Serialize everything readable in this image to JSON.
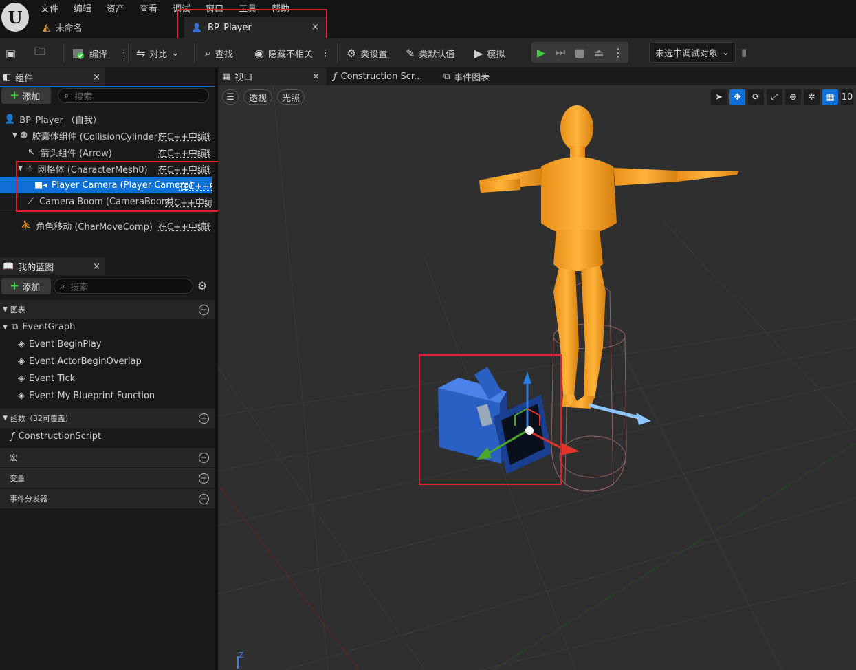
{
  "menu": [
    "文件",
    "编辑",
    "资产",
    "查看",
    "调试",
    "窗口",
    "工具",
    "帮助"
  ],
  "docs": {
    "untitled": "未命名",
    "active_tab": "BP_Player"
  },
  "toolbar": {
    "compile": "编译",
    "diff": "对比",
    "find": "查找",
    "hide_unrelated": "隐藏不相关",
    "class_settings": "类设置",
    "class_defaults": "类默认值",
    "simulate": "模拟",
    "debug_object": "未选中调试对象"
  },
  "components": {
    "tab": "组件",
    "add": "添加",
    "search_placeholder": "搜索",
    "root": "BP_Player （自我）",
    "edit_cpp": "在C++中编辑",
    "edit_cpp_short": "在C++中",
    "items": [
      {
        "label": "胶囊体组件 (CollisionCylinder)"
      },
      {
        "label": "箭头组件 (Arrow)"
      },
      {
        "label": "网格体 (CharacterMesh0)"
      },
      {
        "label": "Player Camera (Player Camera)"
      },
      {
        "label": "Camera Boom (CameraBoom)"
      },
      {
        "label": "角色移动 (CharMoveComp)"
      }
    ]
  },
  "myblueprint": {
    "tab": "我的蓝图",
    "add": "添加",
    "search_placeholder": "搜索",
    "graphs": "图表",
    "eventgraph": "EventGraph",
    "events": [
      "Event BeginPlay",
      "Event ActorBeginOverlap",
      "Event Tick",
      "Event My Blueprint Function"
    ],
    "functions": "函数（32可覆盖）",
    "construction": "ConstructionScript",
    "macros": "宏",
    "variables": "变量",
    "dispatchers": "事件分发器"
  },
  "viewport": {
    "tabs": [
      "视口",
      "Construction Scr...",
      "事件图表"
    ],
    "perspective": "透视",
    "lit": "光照",
    "grid_value": "10",
    "axis_label": "Z"
  },
  "colors": {
    "accent": "#0e6fd6",
    "highlight_box": "#e0212b",
    "play": "#3fcb3f",
    "character": "#f5a623"
  }
}
